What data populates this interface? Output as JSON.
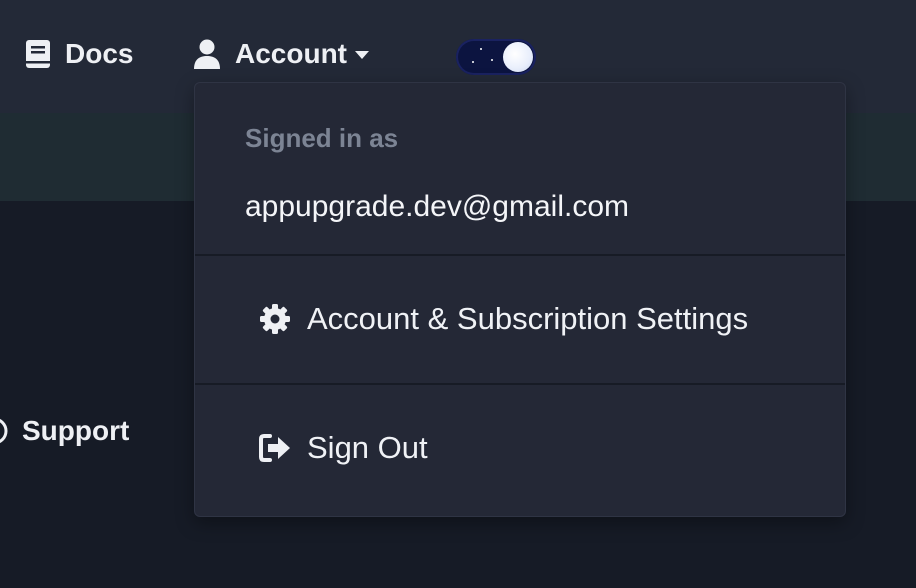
{
  "nav": {
    "docs_label": "Docs",
    "account_label": "Account",
    "support_label": "Support"
  },
  "theme_toggle": {
    "state": "dark"
  },
  "dropdown": {
    "header": "Signed in as",
    "email": "appupgrade.dev@gmail.com",
    "items": [
      {
        "label": "Account & Subscription Settings",
        "icon": "gear-icon"
      },
      {
        "label": "Sign Out",
        "icon": "sign-out-icon"
      }
    ]
  },
  "colors": {
    "topbar": "#232937",
    "band": "#1f2c33",
    "page": "#161b26",
    "dropdown": "#242836",
    "muted_text": "#7c8494"
  }
}
